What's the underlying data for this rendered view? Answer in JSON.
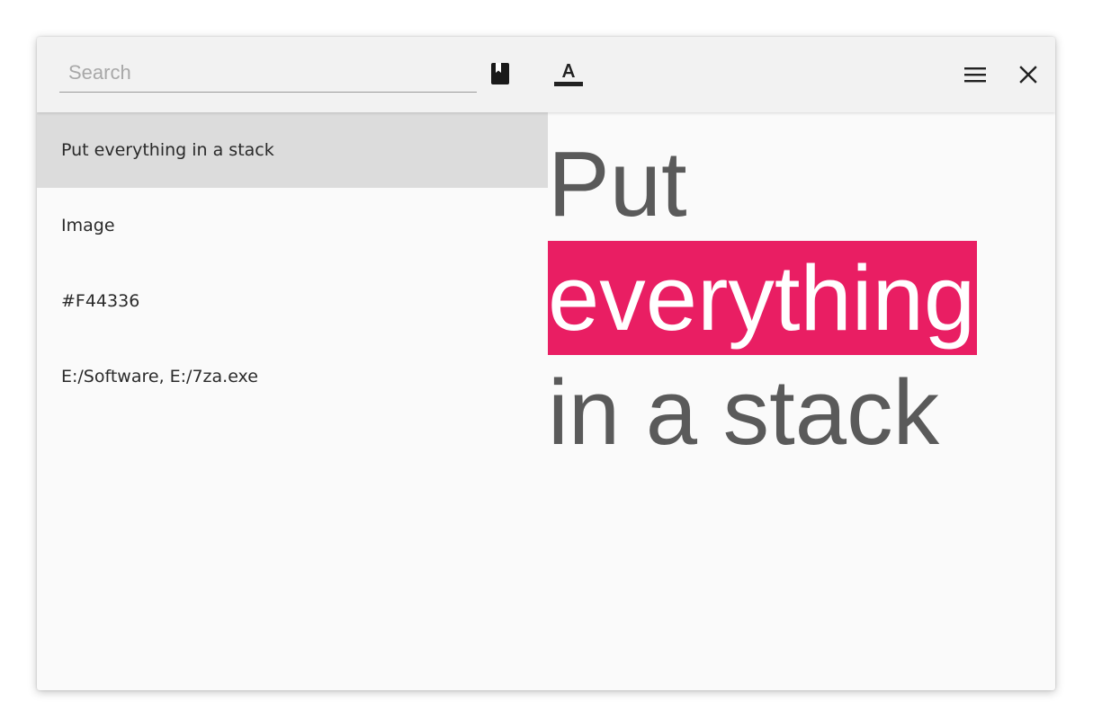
{
  "toolbar": {
    "search_placeholder": "Search",
    "icons": {
      "book": "book-icon",
      "format": "text-format-icon",
      "menu": "menu-icon",
      "close": "close-icon"
    }
  },
  "clips": [
    {
      "label": "Put everything in a stack",
      "selected": true
    },
    {
      "label": "Image",
      "selected": false
    },
    {
      "label": "#F44336",
      "selected": false
    },
    {
      "label": "E:/Software, E:/7za.exe",
      "selected": false
    }
  ],
  "preview": {
    "line1": "Put",
    "line2": "everything",
    "line3": "in a stack"
  },
  "colors": {
    "highlight": "#e91e63",
    "preview_text": "#5a5a5a",
    "selected_row": "#dcdcdc",
    "toolbar": "#f2f2f2"
  }
}
